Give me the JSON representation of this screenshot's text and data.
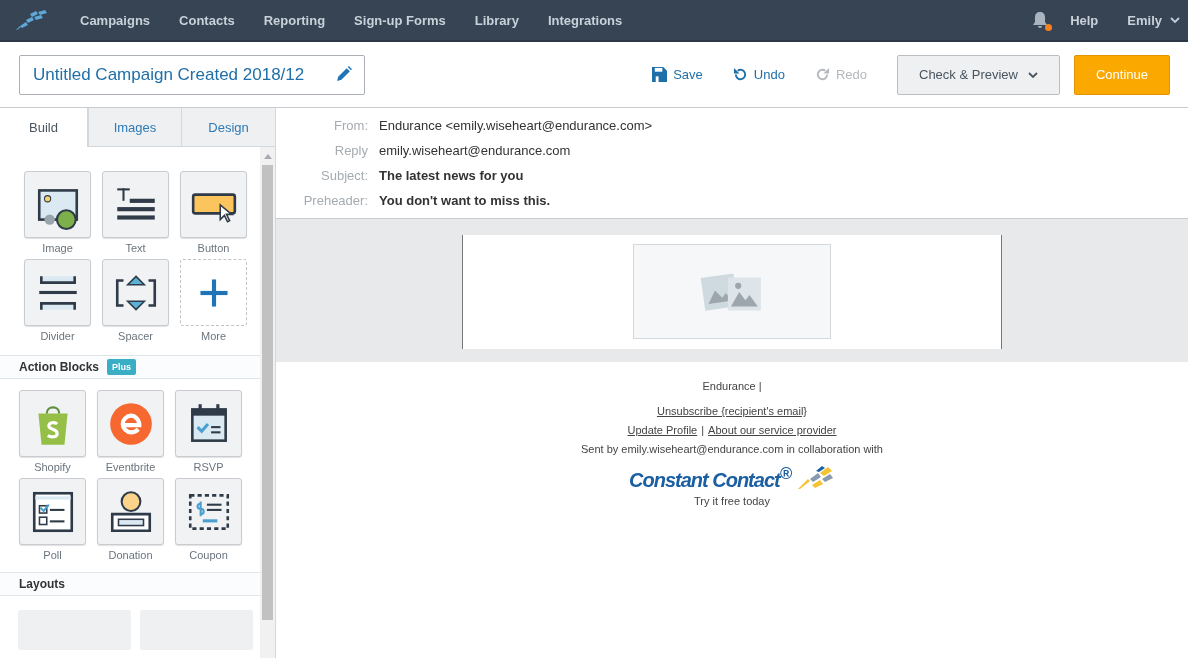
{
  "nav": {
    "items": [
      "Campaigns",
      "Contacts",
      "Reporting",
      "Sign-up Forms",
      "Library",
      "Integrations"
    ],
    "notification_unread": true,
    "help": "Help",
    "user": "Emily"
  },
  "toolbar": {
    "title": "Untitled Campaign Created 2018/12",
    "actions": [
      {
        "kind": "save",
        "label": "Save",
        "disabled": false
      },
      {
        "kind": "undo",
        "label": "Undo",
        "disabled": false
      },
      {
        "kind": "redo",
        "label": "Redo",
        "disabled": true
      }
    ],
    "preview": "Check & Preview",
    "continue": "Continue"
  },
  "sidebar": {
    "tabs": [
      {
        "label": "Build",
        "selected": true
      },
      {
        "label": "Images",
        "selected": false
      },
      {
        "label": "Design",
        "selected": false
      }
    ],
    "blocks": [
      {
        "kind": "image",
        "label": "Image"
      },
      {
        "kind": "text",
        "label": "Text"
      },
      {
        "kind": "button",
        "label": "Button"
      },
      {
        "kind": "divider",
        "label": "Divider"
      },
      {
        "kind": "spacer",
        "label": "Spacer"
      },
      {
        "kind": "more",
        "label": "More"
      }
    ],
    "action_blocks": {
      "title": "Action Blocks",
      "badge": "Plus",
      "items": [
        {
          "kind": "shopify",
          "label": "Shopify"
        },
        {
          "kind": "eventbrite",
          "label": "Eventbrite"
        },
        {
          "kind": "rsvp",
          "label": "RSVP"
        },
        {
          "kind": "poll",
          "label": "Poll"
        },
        {
          "kind": "donation",
          "label": "Donation"
        },
        {
          "kind": "coupon",
          "label": "Coupon"
        }
      ]
    },
    "layouts": {
      "title": "Layouts"
    }
  },
  "email_header": [
    {
      "label": "From:",
      "value": "Endurance <emily.wiseheart@endurance.com>",
      "bold": false
    },
    {
      "label": "Reply",
      "value": "emily.wiseheart@endurance.com",
      "bold": false
    },
    {
      "label": "Subject:",
      "value": "The latest news for you",
      "bold": true
    },
    {
      "label": "Preheader:",
      "value": "You don't want to miss this.",
      "bold": true
    }
  ],
  "footer": {
    "company": "Endurance |",
    "unsubscribe": "Unsubscribe {recipient's email}",
    "links": [
      "Update Profile",
      "About our service provider"
    ],
    "separator": "|",
    "sent_by": "Sent by emily.wiseheart@endurance.com in collaboration with",
    "logo": "Constant Contact$^{®}$",
    "tagline": "Try it free today"
  }
}
